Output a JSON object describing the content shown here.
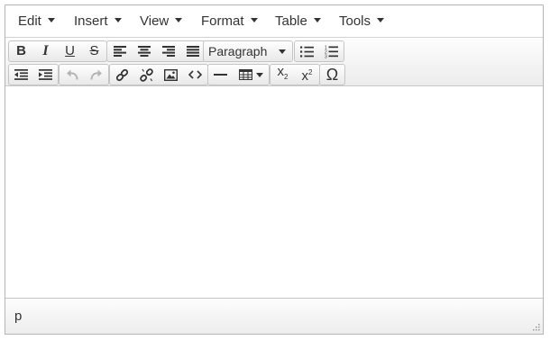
{
  "menubar": {
    "items": [
      {
        "label": "Edit"
      },
      {
        "label": "Insert"
      },
      {
        "label": "View"
      },
      {
        "label": "Format"
      },
      {
        "label": "Table"
      },
      {
        "label": "Tools"
      }
    ]
  },
  "toolbar": {
    "bold": "B",
    "italic": "I",
    "underline": "U",
    "strikethrough": "S",
    "block_format": "Paragraph",
    "subscript": "x",
    "subscript_mark": "2",
    "superscript": "x",
    "superscript_mark": "2",
    "special_char": "Ω"
  },
  "statusbar": {
    "path": "p"
  },
  "icons": [
    "bold-icon",
    "italic-icon",
    "underline-icon",
    "strikethrough-icon",
    "align-left-icon",
    "align-center-icon",
    "align-right-icon",
    "align-justify-icon",
    "bullet-list-icon",
    "numbered-list-icon",
    "outdent-icon",
    "indent-icon",
    "undo-icon",
    "redo-icon",
    "link-icon",
    "unlink-icon",
    "image-icon",
    "code-icon",
    "horizontal-rule-icon",
    "table-icon",
    "subscript-icon",
    "superscript-icon",
    "special-character-icon",
    "resize-handle-icon"
  ],
  "colors": {
    "border": "#b5b5b5",
    "toolbar_bg": "#ececec",
    "text": "#333333",
    "disabled": "#b4b4b4"
  }
}
